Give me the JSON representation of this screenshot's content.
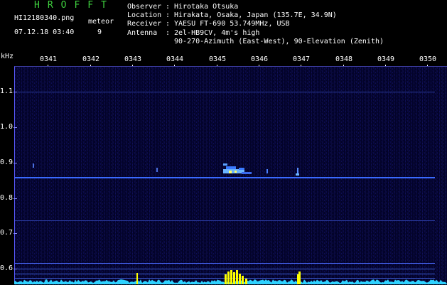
{
  "header": {
    "app_title": "HROFFT",
    "filename": "HI12180340.png",
    "meteor_label": "meteor",
    "meteor_count": "9",
    "datetime": "07.12.18 03:40",
    "observer_key": "Observer",
    "observer_val": "Hirotaka Otsuka",
    "location_key": "Location",
    "location_val": "Hirakata, Osaka, Japan (135.7E, 34.9N)",
    "receiver_key": "Receiver",
    "receiver_val": "YAESU FT-690 53.749MHz, USB",
    "antenna_key": "Antenna",
    "antenna_val": "2el-HB9CV, 4m's high",
    "antenna_val2": "90-270-Azimuth (East-West), 90-Elevation (Zenith)"
  },
  "axis": {
    "unit": "kHz",
    "y_labels": [
      "1.1",
      "1.0",
      "0.9",
      "0.8",
      "0.7",
      "0.6"
    ],
    "x_labels": [
      "0341",
      "0342",
      "0343",
      "0344",
      "0345",
      "0346",
      "0347",
      "0348",
      "0349",
      "0350"
    ]
  },
  "colors": {
    "title": "#3fd13f",
    "background": "#03032a",
    "carrier_line": "#3a5aff",
    "meteor": "#5aa0ff",
    "spectrum": "#2fd2ff",
    "spectrum_peak": "#ffff00"
  }
}
